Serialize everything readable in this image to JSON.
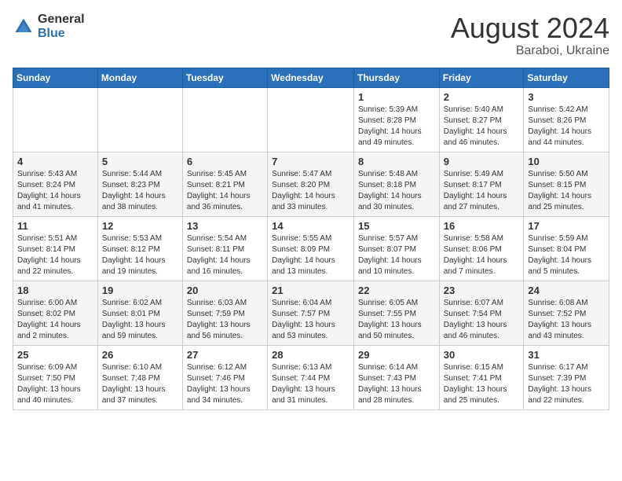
{
  "logo": {
    "general": "General",
    "blue": "Blue"
  },
  "title": {
    "month_year": "August 2024",
    "location": "Baraboi, Ukraine"
  },
  "days_of_week": [
    "Sunday",
    "Monday",
    "Tuesday",
    "Wednesday",
    "Thursday",
    "Friday",
    "Saturday"
  ],
  "weeks": [
    [
      {
        "day": "",
        "info": ""
      },
      {
        "day": "",
        "info": ""
      },
      {
        "day": "",
        "info": ""
      },
      {
        "day": "",
        "info": ""
      },
      {
        "day": "1",
        "info": "Sunrise: 5:39 AM\nSunset: 8:28 PM\nDaylight: 14 hours\nand 49 minutes."
      },
      {
        "day": "2",
        "info": "Sunrise: 5:40 AM\nSunset: 8:27 PM\nDaylight: 14 hours\nand 46 minutes."
      },
      {
        "day": "3",
        "info": "Sunrise: 5:42 AM\nSunset: 8:26 PM\nDaylight: 14 hours\nand 44 minutes."
      }
    ],
    [
      {
        "day": "4",
        "info": "Sunrise: 5:43 AM\nSunset: 8:24 PM\nDaylight: 14 hours\nand 41 minutes."
      },
      {
        "day": "5",
        "info": "Sunrise: 5:44 AM\nSunset: 8:23 PM\nDaylight: 14 hours\nand 38 minutes."
      },
      {
        "day": "6",
        "info": "Sunrise: 5:45 AM\nSunset: 8:21 PM\nDaylight: 14 hours\nand 36 minutes."
      },
      {
        "day": "7",
        "info": "Sunrise: 5:47 AM\nSunset: 8:20 PM\nDaylight: 14 hours\nand 33 minutes."
      },
      {
        "day": "8",
        "info": "Sunrise: 5:48 AM\nSunset: 8:18 PM\nDaylight: 14 hours\nand 30 minutes."
      },
      {
        "day": "9",
        "info": "Sunrise: 5:49 AM\nSunset: 8:17 PM\nDaylight: 14 hours\nand 27 minutes."
      },
      {
        "day": "10",
        "info": "Sunrise: 5:50 AM\nSunset: 8:15 PM\nDaylight: 14 hours\nand 25 minutes."
      }
    ],
    [
      {
        "day": "11",
        "info": "Sunrise: 5:51 AM\nSunset: 8:14 PM\nDaylight: 14 hours\nand 22 minutes."
      },
      {
        "day": "12",
        "info": "Sunrise: 5:53 AM\nSunset: 8:12 PM\nDaylight: 14 hours\nand 19 minutes."
      },
      {
        "day": "13",
        "info": "Sunrise: 5:54 AM\nSunset: 8:11 PM\nDaylight: 14 hours\nand 16 minutes."
      },
      {
        "day": "14",
        "info": "Sunrise: 5:55 AM\nSunset: 8:09 PM\nDaylight: 14 hours\nand 13 minutes."
      },
      {
        "day": "15",
        "info": "Sunrise: 5:57 AM\nSunset: 8:07 PM\nDaylight: 14 hours\nand 10 minutes."
      },
      {
        "day": "16",
        "info": "Sunrise: 5:58 AM\nSunset: 8:06 PM\nDaylight: 14 hours\nand 7 minutes."
      },
      {
        "day": "17",
        "info": "Sunrise: 5:59 AM\nSunset: 8:04 PM\nDaylight: 14 hours\nand 5 minutes."
      }
    ],
    [
      {
        "day": "18",
        "info": "Sunrise: 6:00 AM\nSunset: 8:02 PM\nDaylight: 14 hours\nand 2 minutes."
      },
      {
        "day": "19",
        "info": "Sunrise: 6:02 AM\nSunset: 8:01 PM\nDaylight: 13 hours\nand 59 minutes."
      },
      {
        "day": "20",
        "info": "Sunrise: 6:03 AM\nSunset: 7:59 PM\nDaylight: 13 hours\nand 56 minutes."
      },
      {
        "day": "21",
        "info": "Sunrise: 6:04 AM\nSunset: 7:57 PM\nDaylight: 13 hours\nand 53 minutes."
      },
      {
        "day": "22",
        "info": "Sunrise: 6:05 AM\nSunset: 7:55 PM\nDaylight: 13 hours\nand 50 minutes."
      },
      {
        "day": "23",
        "info": "Sunrise: 6:07 AM\nSunset: 7:54 PM\nDaylight: 13 hours\nand 46 minutes."
      },
      {
        "day": "24",
        "info": "Sunrise: 6:08 AM\nSunset: 7:52 PM\nDaylight: 13 hours\nand 43 minutes."
      }
    ],
    [
      {
        "day": "25",
        "info": "Sunrise: 6:09 AM\nSunset: 7:50 PM\nDaylight: 13 hours\nand 40 minutes."
      },
      {
        "day": "26",
        "info": "Sunrise: 6:10 AM\nSunset: 7:48 PM\nDaylight: 13 hours\nand 37 minutes."
      },
      {
        "day": "27",
        "info": "Sunrise: 6:12 AM\nSunset: 7:46 PM\nDaylight: 13 hours\nand 34 minutes."
      },
      {
        "day": "28",
        "info": "Sunrise: 6:13 AM\nSunset: 7:44 PM\nDaylight: 13 hours\nand 31 minutes."
      },
      {
        "day": "29",
        "info": "Sunrise: 6:14 AM\nSunset: 7:43 PM\nDaylight: 13 hours\nand 28 minutes."
      },
      {
        "day": "30",
        "info": "Sunrise: 6:15 AM\nSunset: 7:41 PM\nDaylight: 13 hours\nand 25 minutes."
      },
      {
        "day": "31",
        "info": "Sunrise: 6:17 AM\nSunset: 7:39 PM\nDaylight: 13 hours\nand 22 minutes."
      }
    ]
  ]
}
